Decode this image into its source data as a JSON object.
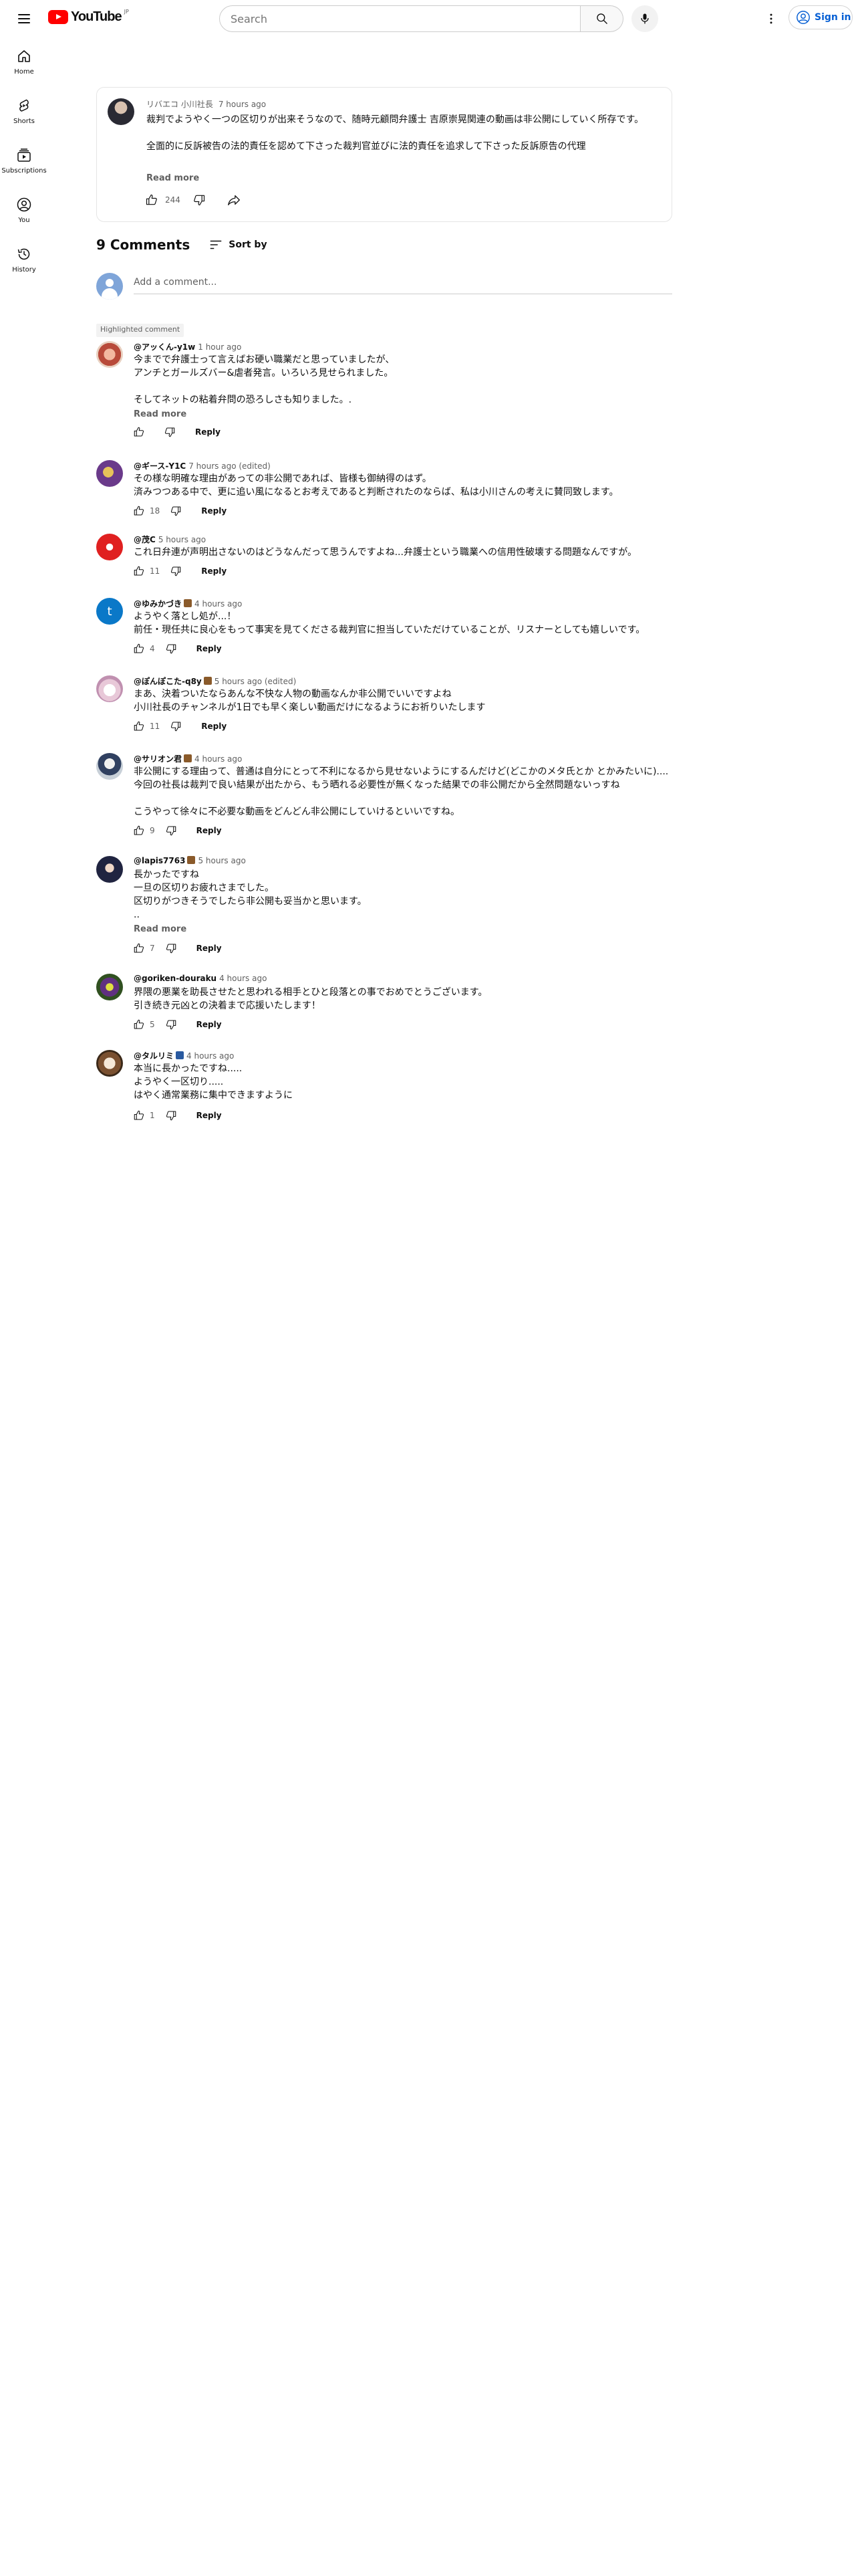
{
  "header": {
    "logo_text": "YouTube",
    "logo_country": "JP",
    "search_placeholder": "Search",
    "signin_label": "Sign in"
  },
  "sidebar": {
    "items": [
      {
        "label": "Home",
        "icon": "home-icon"
      },
      {
        "label": "Shorts",
        "icon": "shorts-icon"
      },
      {
        "label": "Subscriptions",
        "icon": "subscriptions-icon"
      },
      {
        "label": "You",
        "icon": "you-icon"
      },
      {
        "label": "History",
        "icon": "history-icon"
      }
    ]
  },
  "post": {
    "author": "リバエコ 小川社長",
    "time": "7 hours ago",
    "paragraph1": "裁判でようやく一つの区切りが出来そうなので、随時元顧問弁護士 吉原崇晃関連の動画は非公開にしていく所存です。",
    "paragraph2": "全面的に反訴被告の法的責任を認めて下さった裁判官並びに法的責任を追求して下さった反訴原告の代理",
    "read_more": "Read more",
    "likes": "244"
  },
  "comments_header": {
    "count_label": "9 Comments",
    "sort_label": "Sort by"
  },
  "add_comment_placeholder": "Add a comment...",
  "highlighted_label": "Highlighted comment",
  "reply_label": "Reply",
  "read_more_label": "Read more",
  "comments": [
    {
      "author": "@アッくん-y1w",
      "time": "1 hour ago",
      "text": "今までで弁護士って言えばお硬い職業だと思っていましたが、\nアンチとガールズバー&虐者発言。いろいろ見せられました。\n\nそしてネットの粘着弁問の恐ろしさも知りました。.",
      "likes": "",
      "read_more": true
    },
    {
      "author": "@ギース-Y1C",
      "time": "7 hours ago (edited)",
      "text": "その様な明確な理由があっての非公開であれば、皆様も御納得のはず。\n済みつつある中で、更に追い風になるとお考えであると判断されたのならば、私は小川さんの考えに賛同致します。",
      "likes": "18",
      "read_more": false
    },
    {
      "author": "@茂C",
      "time": "5 hours ago",
      "text": "これ日弁連が声明出さないのはどうなんだって思うんですよね...弁護士という職業への信用性破壊する問題なんですが。",
      "likes": "11",
      "read_more": false
    },
    {
      "author": "@ゆみかづき",
      "time": "4 hours ago",
      "text": "ようやく落とし処が...！\n前任・現任共に良心をもって事実を見てくださる裁判官に担当していただけていることが、リスナーとしても嬉しいです。",
      "likes": "4",
      "read_more": false
    },
    {
      "author": "@ぽんぽこた-q8y",
      "time": "5 hours ago (edited)",
      "text": "まあ、決着ついたならあんな不快な人物の動画なんか非公開でいいですよね\n小川社長のチャンネルが1日でも早く楽しい動画だけになるようにお祈りいたします",
      "likes": "11",
      "read_more": false
    },
    {
      "author": "@サリオン君",
      "time": "4 hours ago",
      "text": "非公開にする理由って、普通は自分にとって不利になるから見せないようにするんだけど(どこかのメタ氏とか とかみたいに)....今回の社長は裁判で良い結果が出たから、もう晒れる必要性が無くなった結果での非公開だから全然問題ないっすね\n\nこうやって徐々に不必要な動画をどんどん非公開にしていけるといいですね。",
      "likes": "9",
      "read_more": false
    },
    {
      "author": "@lapis7763",
      "time": "5 hours ago",
      "text": "長かったですね\n一旦の区切りお疲れさまでした。\n区切りがつきそうでしたら非公開も妥当かと思います。\n..",
      "likes": "7",
      "read_more": true
    },
    {
      "author": "@goriken-douraku",
      "time": "4 hours ago",
      "text": "界隈の悪業を助長させたと思われる相手とひと段落との事でおめでとうございます。\n引き続き元凶との決着まで応援いたします！",
      "likes": "5",
      "read_more": false
    },
    {
      "author": "@タルリミ",
      "time": "4 hours ago",
      "text": "本当に長かったですね.....\nようやく一区切り.....\nはやく通常業務に集中できますように",
      "likes": "1",
      "read_more": false
    }
  ],
  "colors": {
    "accent_blue": "#065fd4",
    "brand_red": "#ff0000",
    "secondary_text": "#606060"
  }
}
